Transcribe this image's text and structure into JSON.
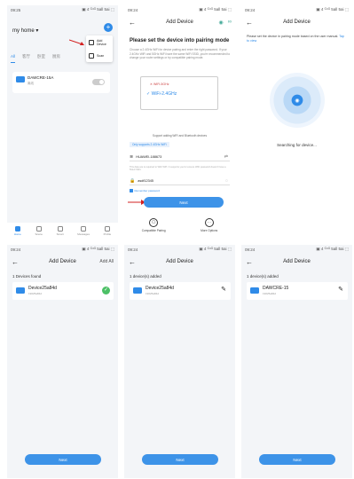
{
  "status": {
    "time1": "09:25",
    "time": "09:24",
    "right": "▣ 4 ᴳ⁴ᴳ 5all 5ai ⬚"
  },
  "p1": {
    "home_title": "my home ▾",
    "menu": [
      "Add Device",
      "Scan"
    ],
    "tabs": [
      "All",
      "客厅",
      "卧室",
      "厨房"
    ],
    "device": {
      "name": "DAWCRE-15A",
      "sub": "离线"
    },
    "tabbar": [
      "Home",
      "Scene",
      "Smart",
      "Messages",
      "Profile"
    ]
  },
  "p2": {
    "nav_title": "Add Device",
    "title": "Please set the device into pairing mode",
    "desc": "Choose a 2.4GHz WiFi for device pairing and enter the right password. If your 2.4GHz WiFi and 5GHz WiFi have the same WiFi SSID, you're recommended to change your router settings or try compatible pairing mode.",
    "wifi_bad": "WiFi-5GHz",
    "wifi_good": "WiFi-2.4GHz",
    "hint": "Support adding WiFi and Bluetooth devices",
    "only_24": "Only supports 2.4GHz WiFi",
    "ssid": "HUAWEI-188673",
    "note": "This data are is required to WiFi WPI. It supports you for ensure WiFi password doesn't have a 5GHz WiFi.",
    "password": "asdf12345",
    "remember": "Remember password",
    "next": "Next",
    "opt1": "Compatible Pairing",
    "opt2": "More Options"
  },
  "p3": {
    "nav_title": "Add Device",
    "desc": "Please set the device in pairing mode based on the user manual.",
    "link": "Tap to view",
    "searching": "Searching for device..."
  },
  "p4": {
    "nav_title": "Add Device",
    "nav_right": "Add All",
    "found": "1 Devices found",
    "device": {
      "name": "Device25a84d",
      "sub": "19025a84d"
    },
    "next": "Next"
  },
  "p5": {
    "nav_title": "Add Device",
    "found": "1 device(s) added",
    "device": {
      "name": "Device25a84d",
      "sub": "19025a84d"
    },
    "next": "Next"
  },
  "p6": {
    "nav_title": "Add Device",
    "found": "1 device(s) added",
    "device": {
      "name": "DAWCRE-15",
      "sub": "19025a84d"
    },
    "next": "Next"
  },
  "colors": {
    "accent": "#2f8be8",
    "success": "#4cc066",
    "annotation": "#d32020"
  }
}
